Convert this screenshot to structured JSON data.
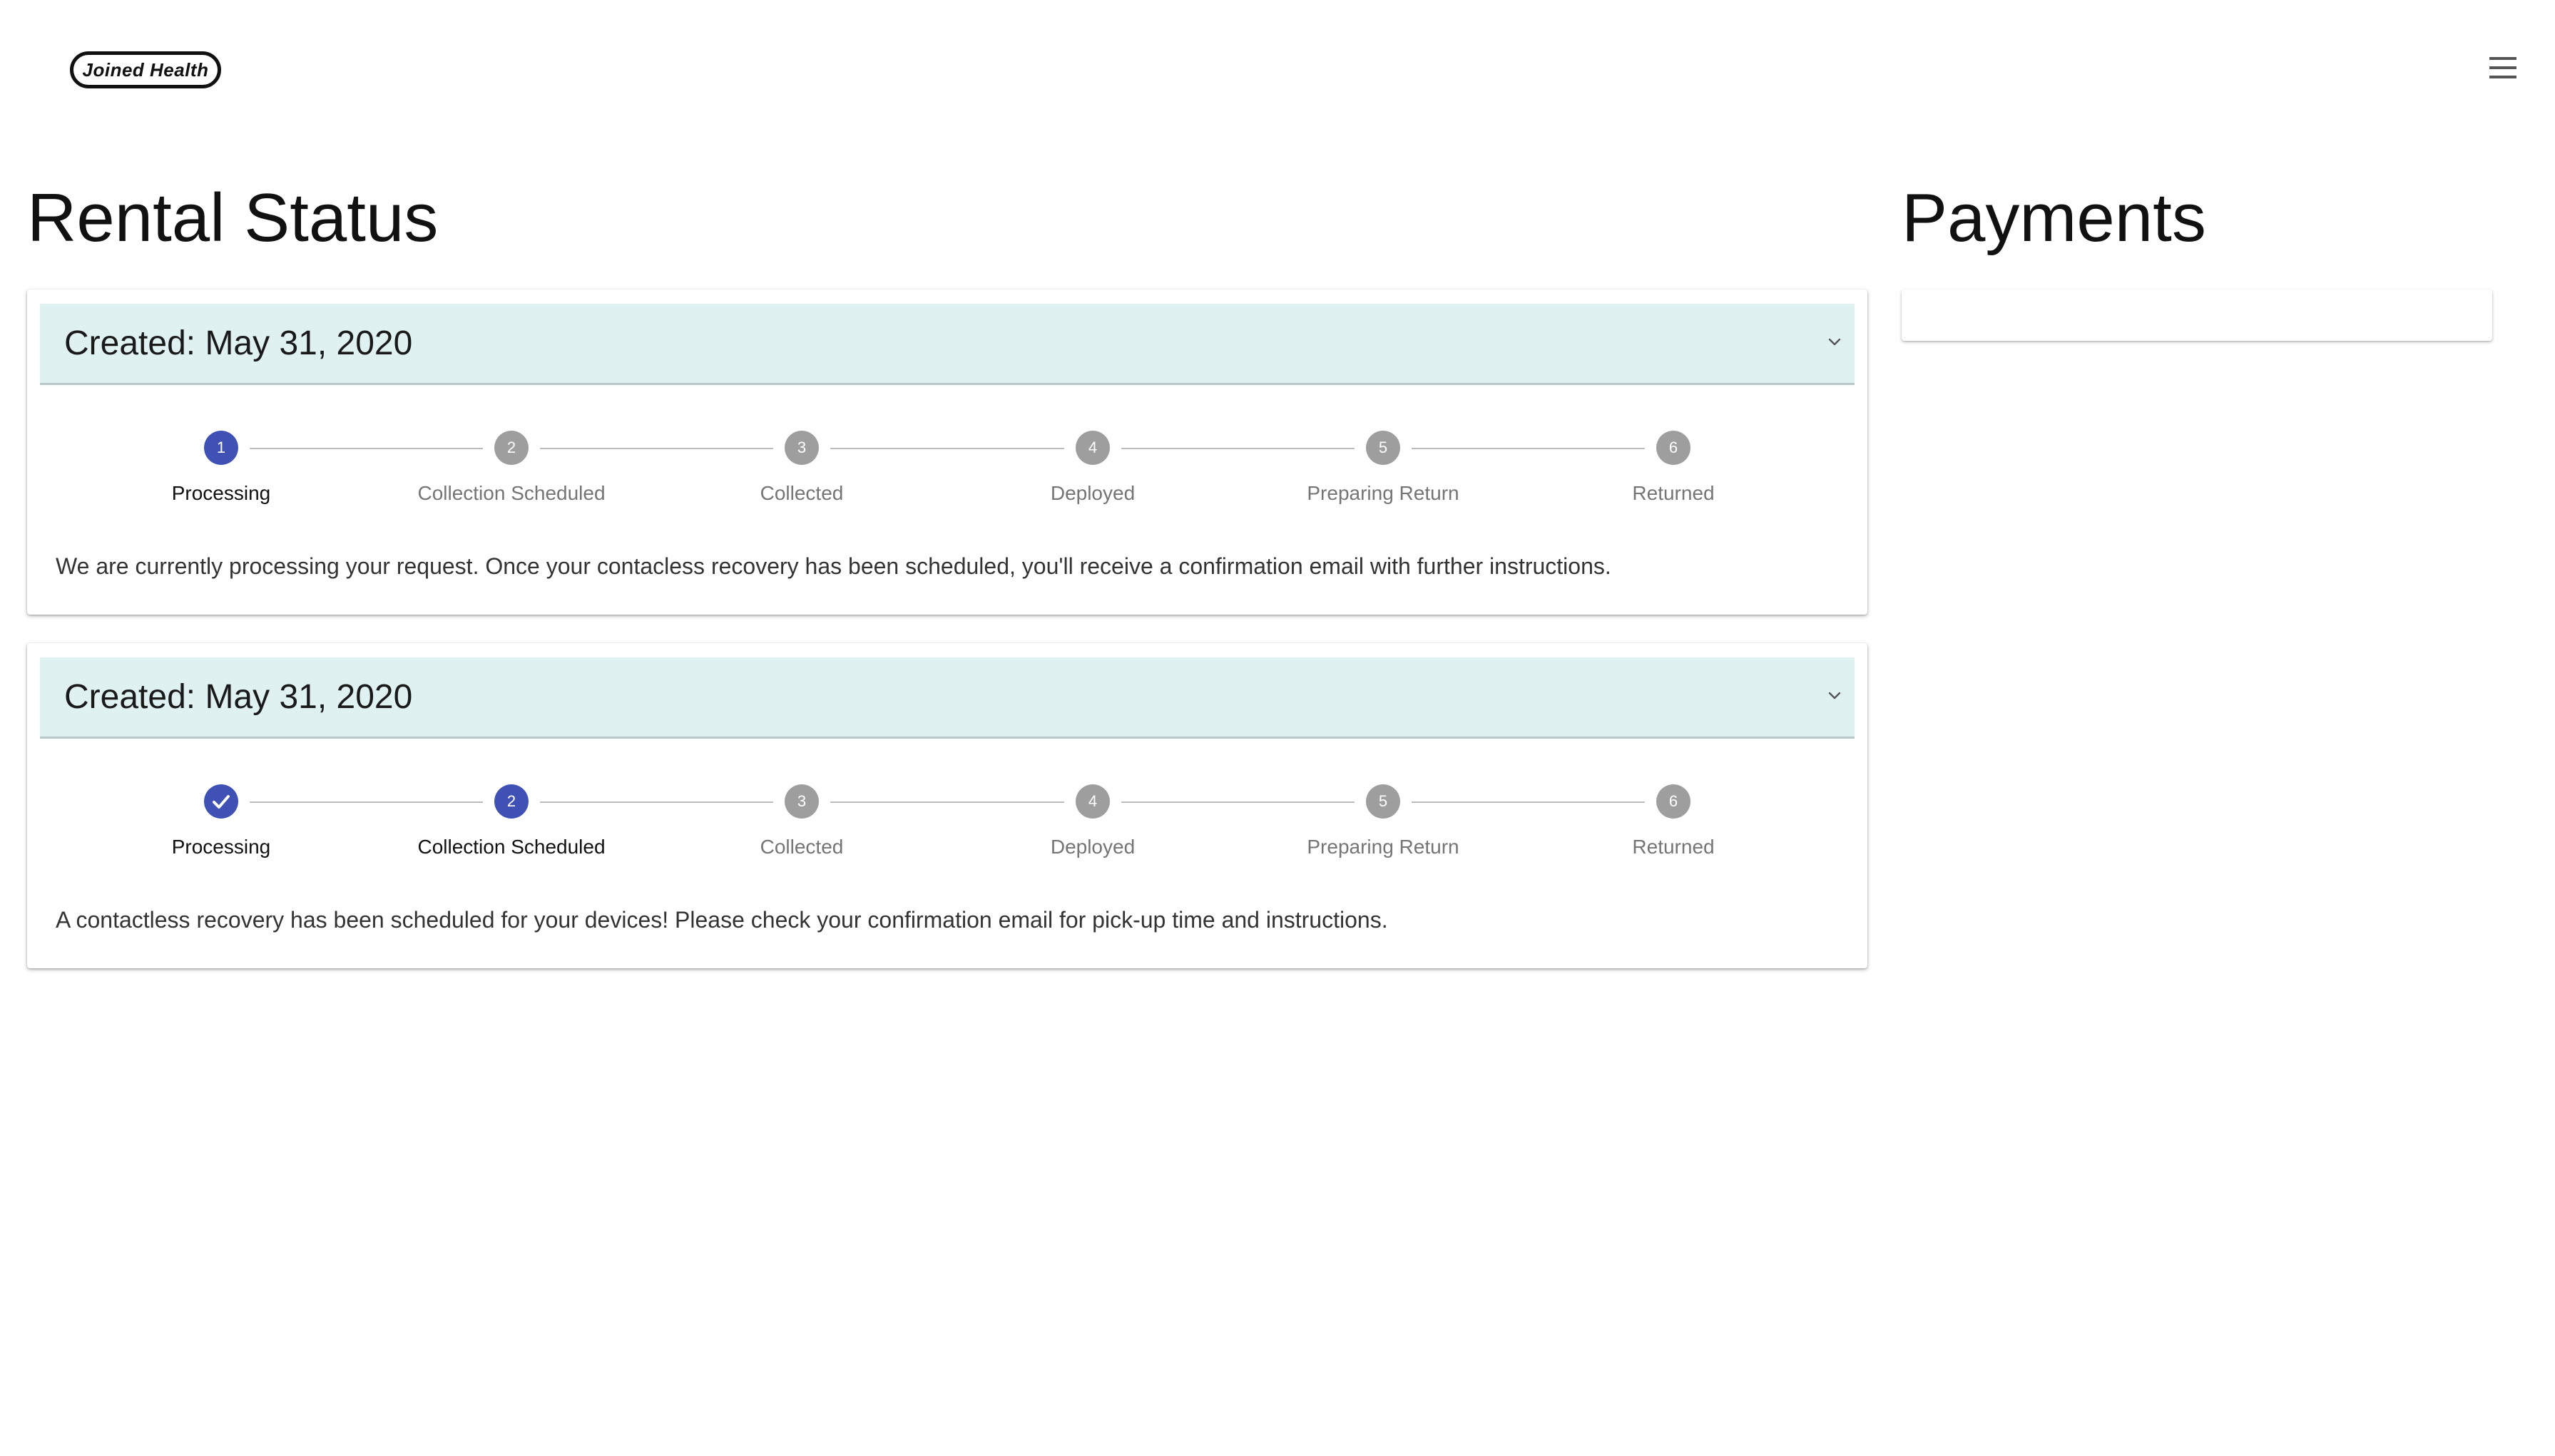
{
  "header": {
    "logo_text": "Joined Health",
    "menu_icon": "hamburger-menu-icon"
  },
  "rental_status": {
    "title": "Rental Status",
    "cards": [
      {
        "created": "Created: May 31, 2020",
        "active_step": 1,
        "steps": [
          {
            "number": "1",
            "label": "Processing",
            "state": "active"
          },
          {
            "number": "2",
            "label": "Collection Scheduled",
            "state": "inactive"
          },
          {
            "number": "3",
            "label": "Collected",
            "state": "inactive"
          },
          {
            "number": "4",
            "label": "Deployed",
            "state": "inactive"
          },
          {
            "number": "5",
            "label": "Preparing Return",
            "state": "inactive"
          },
          {
            "number": "6",
            "label": "Returned",
            "state": "inactive"
          }
        ],
        "message": "We are currently processing your request. Once your contacless recovery has been scheduled, you'll receive a confirmation email with further instructions."
      },
      {
        "created": "Created: May 31, 2020",
        "active_step": 2,
        "steps": [
          {
            "number": "1",
            "label": "Processing",
            "state": "completed"
          },
          {
            "number": "2",
            "label": "Collection Scheduled",
            "state": "active"
          },
          {
            "number": "3",
            "label": "Collected",
            "state": "inactive"
          },
          {
            "number": "4",
            "label": "Deployed",
            "state": "inactive"
          },
          {
            "number": "5",
            "label": "Preparing Return",
            "state": "inactive"
          },
          {
            "number": "6",
            "label": "Returned",
            "state": "inactive"
          }
        ],
        "message": "A contactless recovery has been scheduled for your devices! Please check your confirmation email for pick-up time and instructions."
      }
    ]
  },
  "payments": {
    "title": "Payments"
  },
  "colors": {
    "accent": "#3f51b5",
    "inactive_step": "#9e9e9e",
    "card_header_bg": "#e0f1f1"
  }
}
